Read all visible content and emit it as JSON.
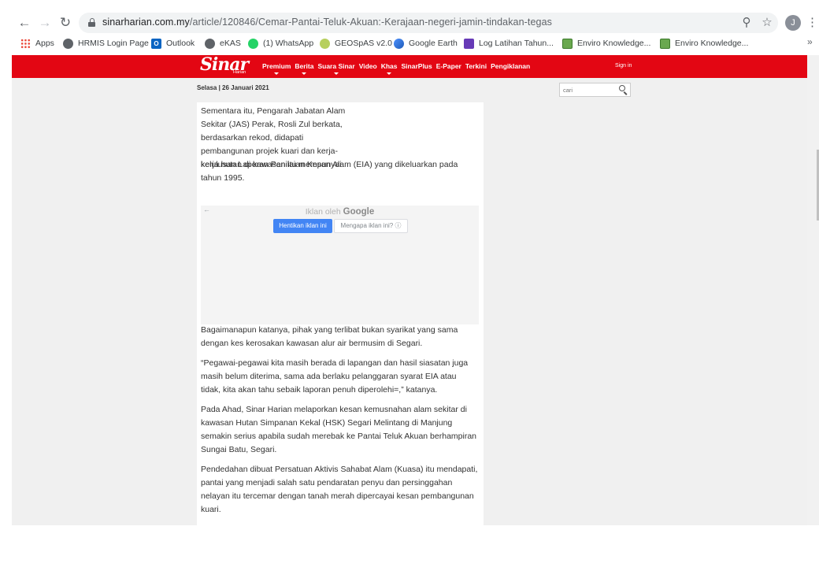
{
  "browser": {
    "url_domain": "sinarharian.com.my",
    "url_path": "/article/120846/Cemar-Pantai-Teluk-Akuan:-Kerajaan-negeri-jamin-tindakan-tegas",
    "profile_initial": "J",
    "bookmarks": [
      {
        "label": "Apps",
        "icon": "apps-grid-icon"
      },
      {
        "label": "HRMIS Login Page",
        "icon": "globe-icon"
      },
      {
        "label": "Outlook",
        "icon": "outlook-icon",
        "icon_text": "O"
      },
      {
        "label": "eKAS",
        "icon": "globe-icon"
      },
      {
        "label": "(1) WhatsApp",
        "icon": "whatsapp-icon"
      },
      {
        "label": "GEOSpAS v2.0",
        "icon": "geospas-icon"
      },
      {
        "label": "Google Earth",
        "icon": "google-earth-icon"
      },
      {
        "label": "Log Latihan Tahun...",
        "icon": "form-icon"
      },
      {
        "label": "Enviro Knowledge...",
        "icon": "enviro-icon"
      },
      {
        "label": "Enviro Knowledge...",
        "icon": "enviro-icon"
      }
    ],
    "more_label": "»"
  },
  "site": {
    "logo": "Sinar",
    "logo_sub": "Harian",
    "nav": [
      "Premium",
      "Berita",
      "Suara Sinar",
      "Video",
      "Khas",
      "SinarPlus",
      "E-Paper",
      "Terkini",
      "Pengiklanan"
    ],
    "signin": "Sign in",
    "date": "Selasa | 26 Januari 2021",
    "search_placeholder": "cari",
    "brand_color": "#e30613"
  },
  "article": {
    "p1": "Sementara itu, Pengarah Jabatan Alam Sekitar (JAS) Perak, Rosli Zul berkata, berdasarkan rekod, didapati pembangunan projek kuari dan kerja-kerja hutan di kawasan itu mempunyai",
    "p1_cont": "kelulusan Laporan Penilaian Kesan Alam (EIA) yang dikeluarkan pada tahun 1995.",
    "ad": {
      "label_prefix": "Iklan oleh",
      "label_brand": "Google",
      "stop_button": "Hentikan iklan ini",
      "why_button": "Mengapa iklan ini? ⓘ"
    },
    "p2": "Bagaimanapun katanya, pihak yang terlibat bukan syarikat yang sama dengan kes kerosakan kawasan alur air bermusim di Segari.",
    "p3": "“Pegawai-pegawai kita masih berada di lapangan dan hasil siasatan juga masih belum diterima, sama ada berlaku pelanggaran syarat EIA atau tidak, kita akan tahu sebaik laporan penuh diperolehi=,” katanya.",
    "p4": "Pada Ahad, Sinar Harian melaporkan kesan kemusnahan alam sekitar di kawasan Hutan Simpanan Kekal (HSK) Segari Melintang di Manjung semakin serius apabila sudah merebak ke Pantai Teluk Akuan berhampiran Sungai Batu, Segari.",
    "p5": "Pendedahan dibuat Persatuan Aktivis Sahabat Alam (Kuasa) itu mendapati, pantai yang menjadi salah satu pendaratan penyu dan persinggahan nelayan itu tercemar dengan tanah merah dipercayai kesan pembangunan kuari."
  }
}
